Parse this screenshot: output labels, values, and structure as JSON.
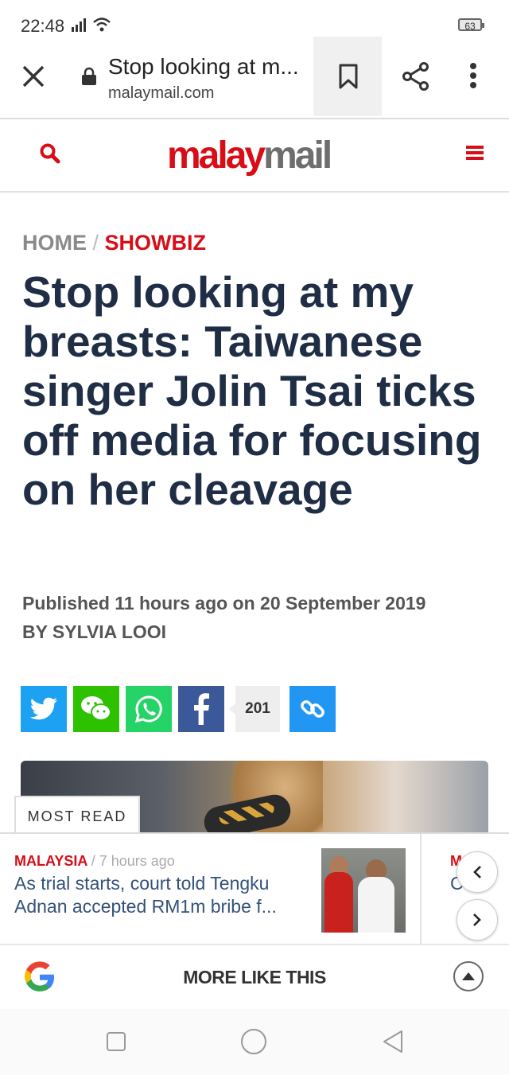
{
  "status_bar": {
    "time": "22:48",
    "battery": "63"
  },
  "browser": {
    "page_title": "Stop looking at m...",
    "domain": "malaymail.com"
  },
  "site": {
    "logo_part1": "malay",
    "logo_part2": "mail"
  },
  "breadcrumb": {
    "home": "HOME",
    "separator": "/",
    "category": "SHOWBIZ"
  },
  "article": {
    "headline": "Stop looking at my breasts: Taiwanese singer Jolin Tsai ticks off media for focusing on her cleavage",
    "published": "Published 11 hours ago on 20 September 2019",
    "byline": "BY SYLVIA LOOI"
  },
  "share": {
    "count": "201"
  },
  "most_read": {
    "label": "MOST READ",
    "items": [
      {
        "category": "MALAYSIA",
        "separator": "/",
        "time": "7 hours ago",
        "title": "As trial starts, court told Tengku Adnan accepted RM1m bribe f..."
      },
      {
        "category": "M",
        "title": "C h"
      }
    ]
  },
  "google_bar": {
    "label": "MORE LIKE THIS"
  },
  "colors": {
    "brand_red": "#d70e17",
    "headline_navy": "#1f2d45",
    "link_blue": "#33517a"
  }
}
